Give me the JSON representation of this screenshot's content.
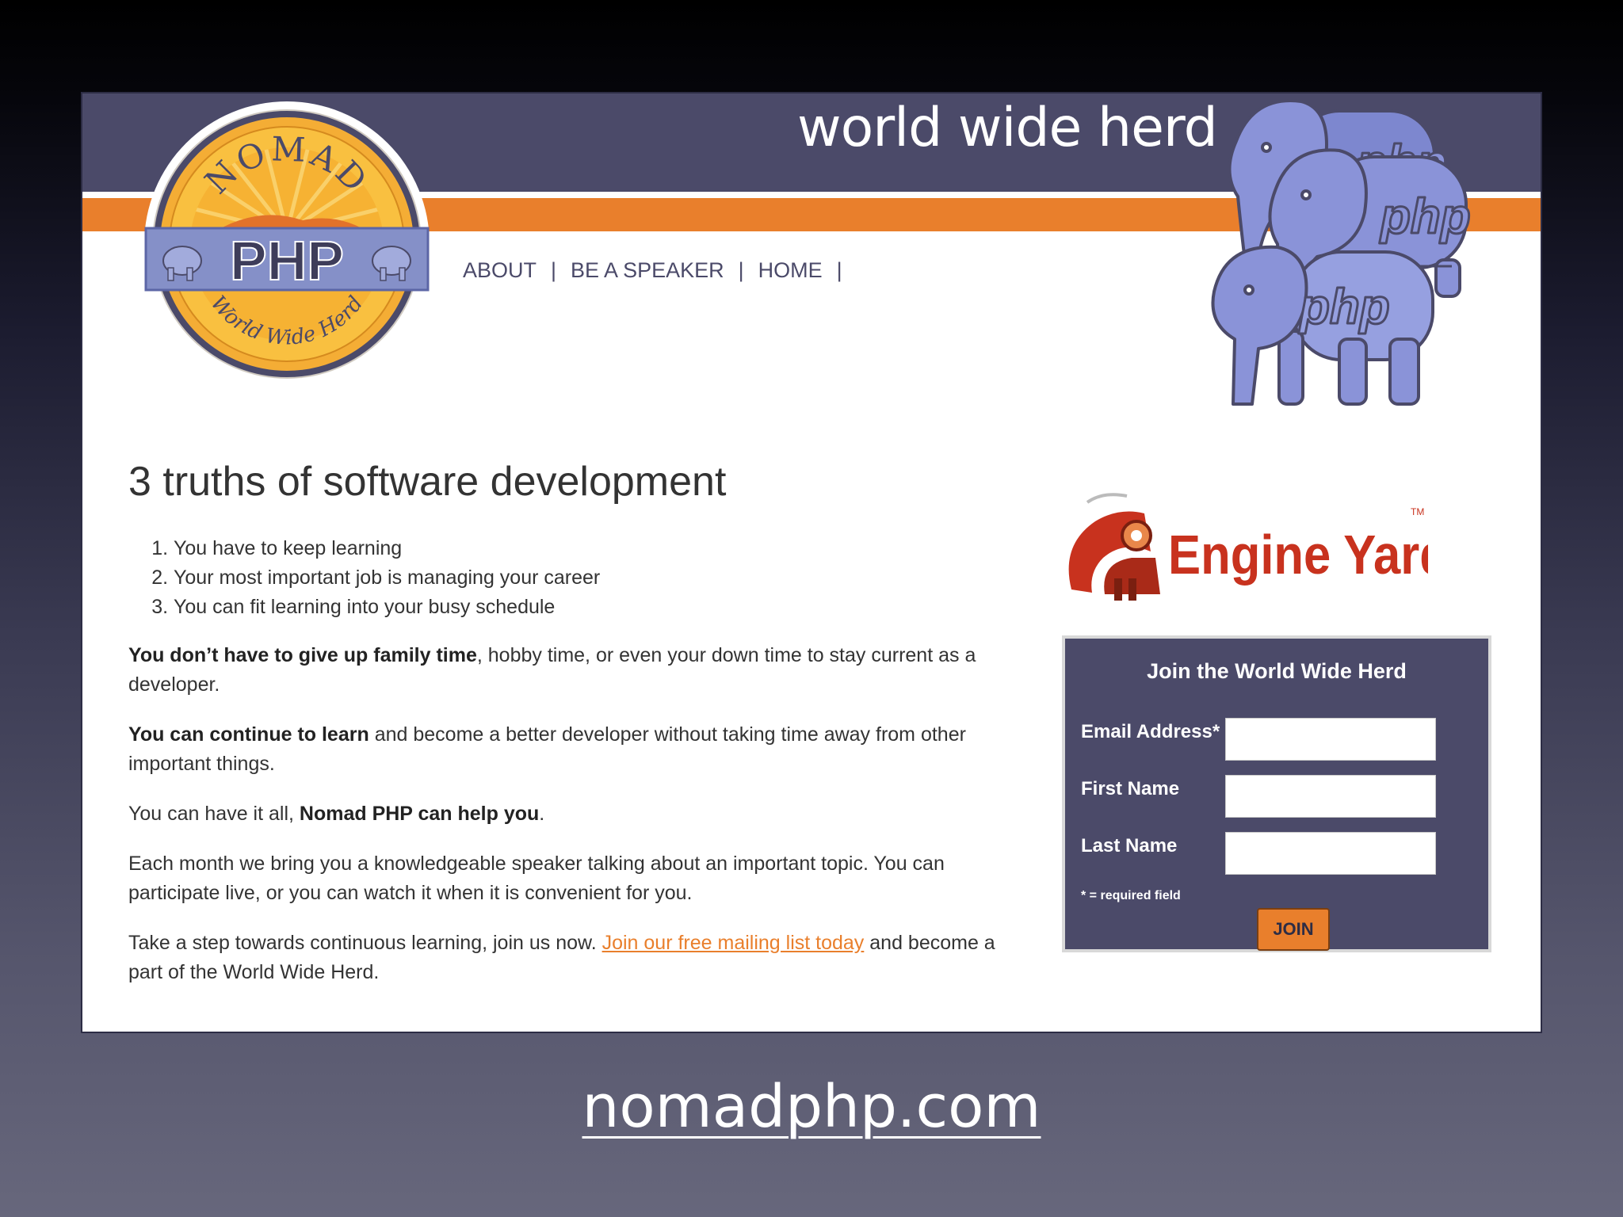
{
  "header": {
    "tagline": "world wide herd",
    "logo": {
      "top_text": "NOMAD",
      "main_text": "PHP",
      "bottom_text": "World Wide Herd",
      "icon": "elephant-icon"
    },
    "mascot_text": "php",
    "mascot_icon": "php-elephant-icon"
  },
  "nav": {
    "items": [
      {
        "label": "ABOUT"
      },
      {
        "label": "BE A SPEAKER"
      },
      {
        "label": "HOME"
      }
    ],
    "separator": "|"
  },
  "main": {
    "headline": "3 truths of software development",
    "truths": [
      "You have to keep learning",
      "Your most important job is managing your career",
      "You can fit learning into your busy schedule"
    ],
    "p1_bold": "You don’t have to give up family time",
    "p1_rest": ", hobby time, or even your down time to stay current as a developer.",
    "p2_bold": "You can continue to learn",
    "p2_rest": " and become a better developer without taking time away from other important things.",
    "p3_start": "You can have it all, ",
    "p3_bold": "Nomad PHP can help you",
    "p3_end": ".",
    "p4": "Each month we bring you a knowledgeable speaker talking about an important topic. You can participate live, or you can watch it when it is convenient for you.",
    "p5_start": "Take a step towards continuous learning, join us now. ",
    "p5_link": "Join our free mailing list today",
    "p5_end": " and become a part of the World Wide Herd."
  },
  "sponsor": {
    "name": "Engine Yard",
    "trademark": "TM",
    "icon": "engine-yard-train-icon"
  },
  "signup": {
    "title": "Join the World Wide Herd",
    "email_label": "Email Address*",
    "email_value": "",
    "first_name_label": "First Name",
    "first_name_value": "",
    "last_name_label": "Last Name",
    "last_name_value": "",
    "required_note": "* = required field",
    "join_label": "JOIN"
  },
  "caption": "nomadphp.com",
  "colors": {
    "brand_purple": "#4b4a69",
    "brand_orange": "#e97f2c",
    "sponsor_red": "#c8321e",
    "elephant_blue": "#8a93d8"
  }
}
